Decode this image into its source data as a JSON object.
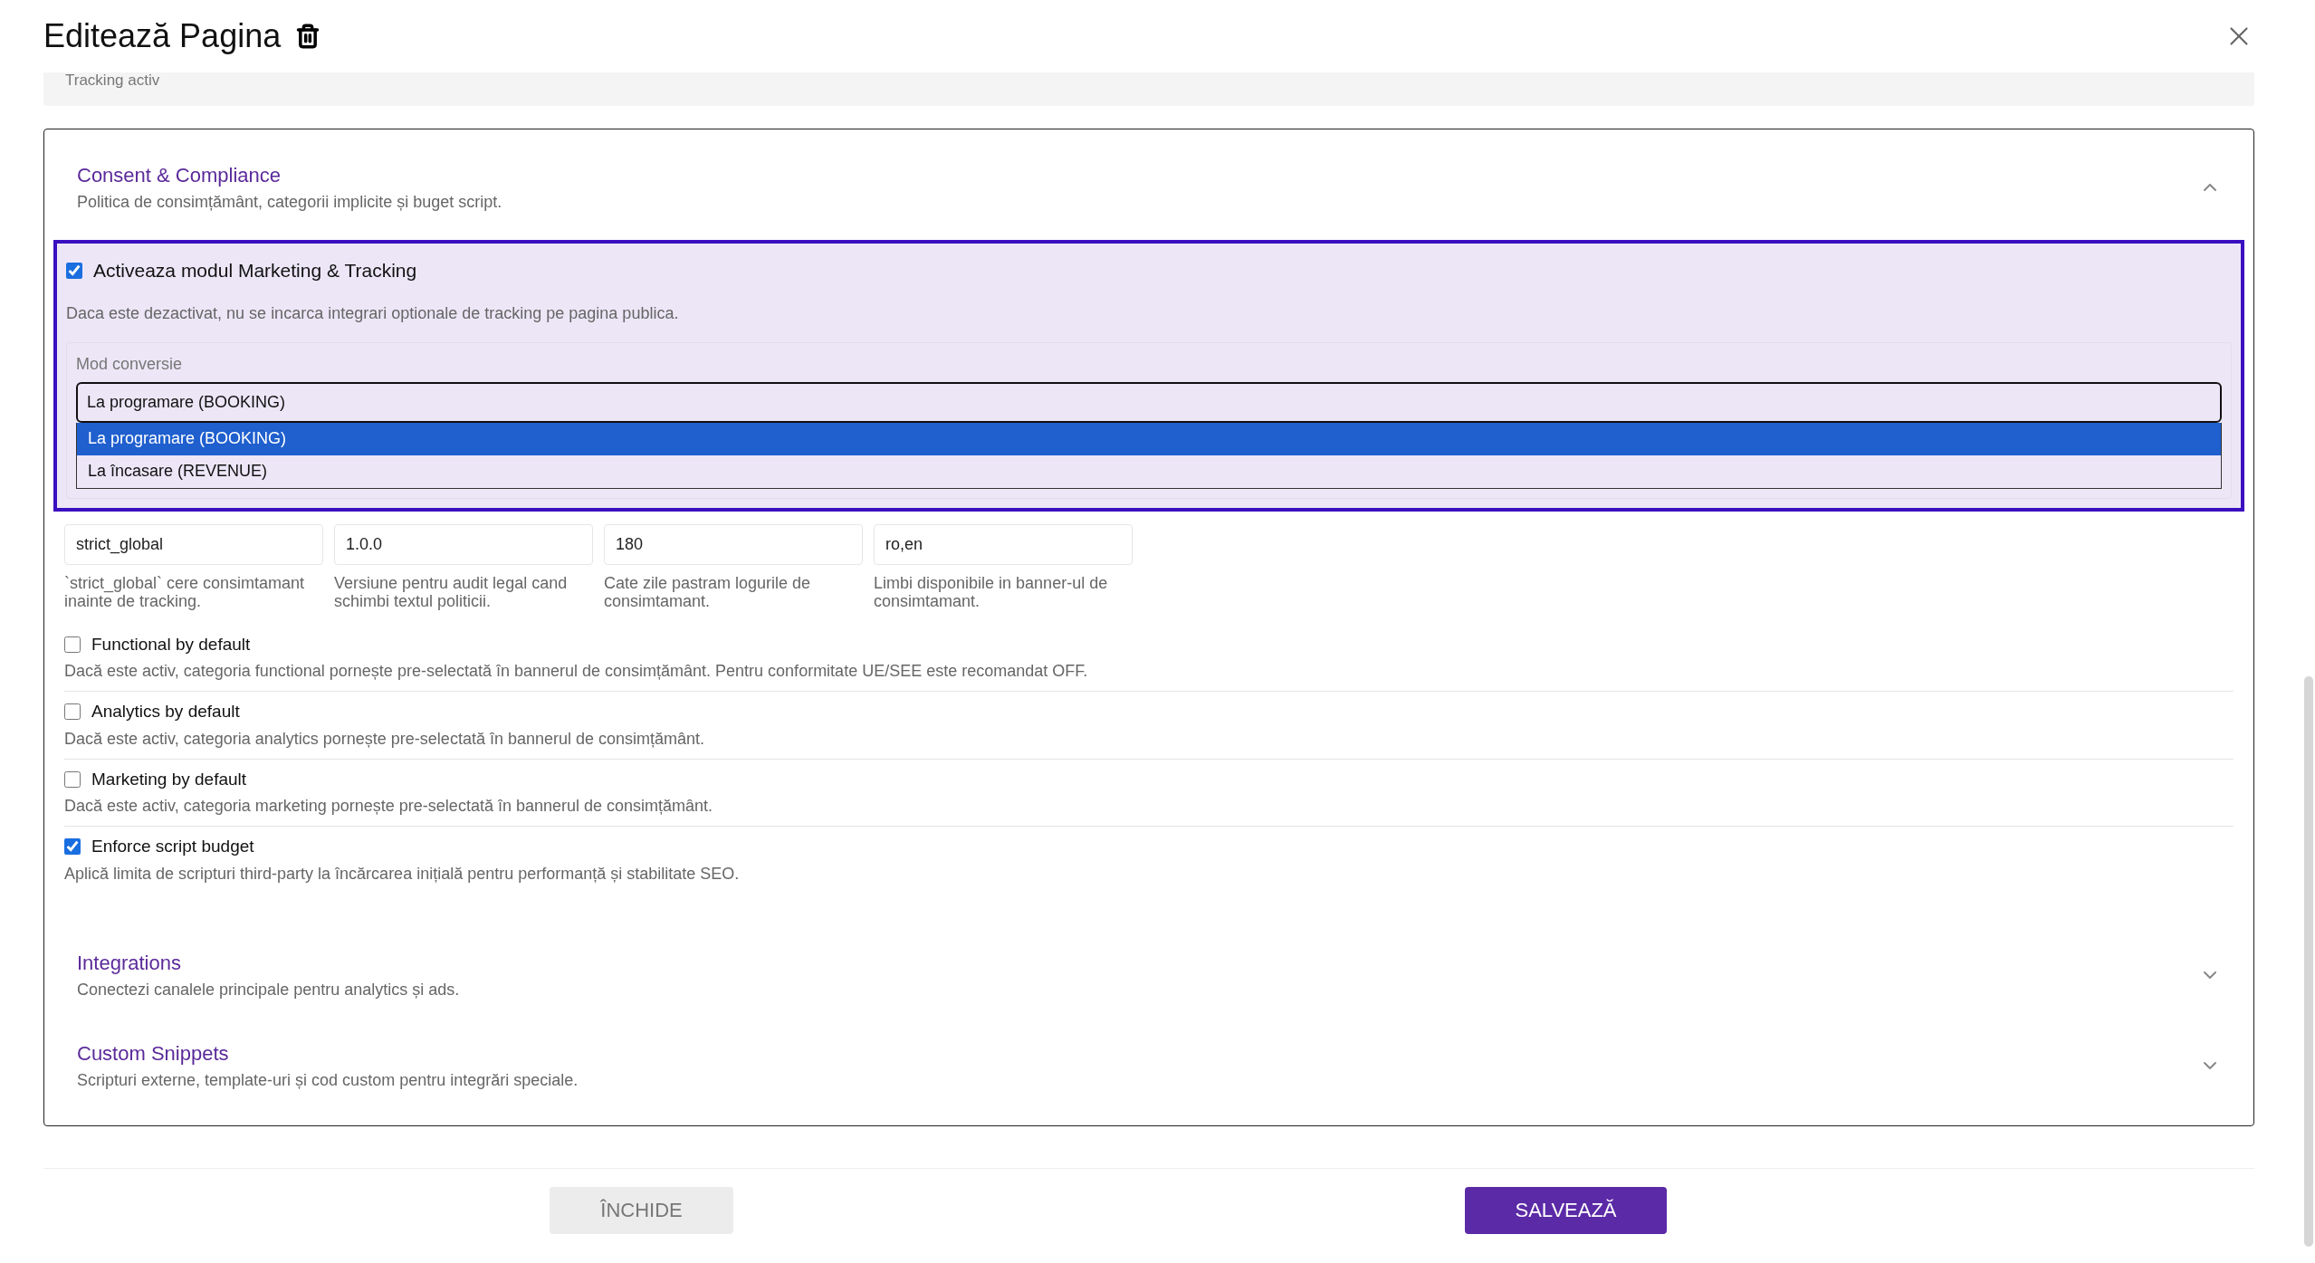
{
  "header": {
    "title": "Editează Pagina"
  },
  "collapsed_summary": {
    "text": "Tracking activ"
  },
  "sections": [
    {
      "title": "Consent & Compliance",
      "subtitle": "Politica de consimțământ, categorii implicite și buget script.",
      "expanded": true
    },
    {
      "title": "Integrations",
      "subtitle": "Conectezi canalele principale pentru analytics și ads.",
      "expanded": false
    },
    {
      "title": "Custom Snippets",
      "subtitle": "Scripturi externe, template-uri și cod custom pentru integrări speciale.",
      "expanded": false
    }
  ],
  "marketing_toggle": {
    "label": "Activeaza modul Marketing & Tracking",
    "checked": true,
    "description": "Daca este dezactivat, nu se incarca integrari optionale de tracking pe pagina publica."
  },
  "conversion_mode": {
    "label": "Mod conversie",
    "value": "La programare (BOOKING)",
    "options": [
      {
        "label": "La programare (BOOKING)",
        "selected": true
      },
      {
        "label": "La încasare (REVENUE)",
        "selected": false
      }
    ]
  },
  "fields": [
    {
      "value": "strict_global",
      "help": "`strict_global` cere consimtamant inainte de tracking."
    },
    {
      "value": "1.0.0",
      "help": "Versiune pentru audit legal cand schimbi textul politicii."
    },
    {
      "value": "180",
      "help": "Cate zile pastram logurile de consimtamant."
    },
    {
      "value": "ro,en",
      "help": "Limbi disponibile in banner-ul de consimtamant."
    }
  ],
  "options": [
    {
      "label": "Functional by default",
      "description": "Dacă este activ, categoria functional pornește pre-selectată în bannerul de consimțământ. Pentru conformitate UE/SEE este recomandat OFF.",
      "checked": false
    },
    {
      "label": "Analytics by default",
      "description": "Dacă este activ, categoria analytics pornește pre-selectată în bannerul de consimțământ.",
      "checked": false
    },
    {
      "label": "Marketing by default",
      "description": "Dacă este activ, categoria marketing pornește pre-selectată în bannerul de consimțământ.",
      "checked": false
    },
    {
      "label": "Enforce script budget",
      "description": "Aplică limita de scripturi third-party la încărcarea inițială pentru performanță și stabilitate SEO.",
      "checked": true
    }
  ],
  "buttons": {
    "close": "ÎNCHIDE",
    "save": "SALVEAZĂ"
  }
}
